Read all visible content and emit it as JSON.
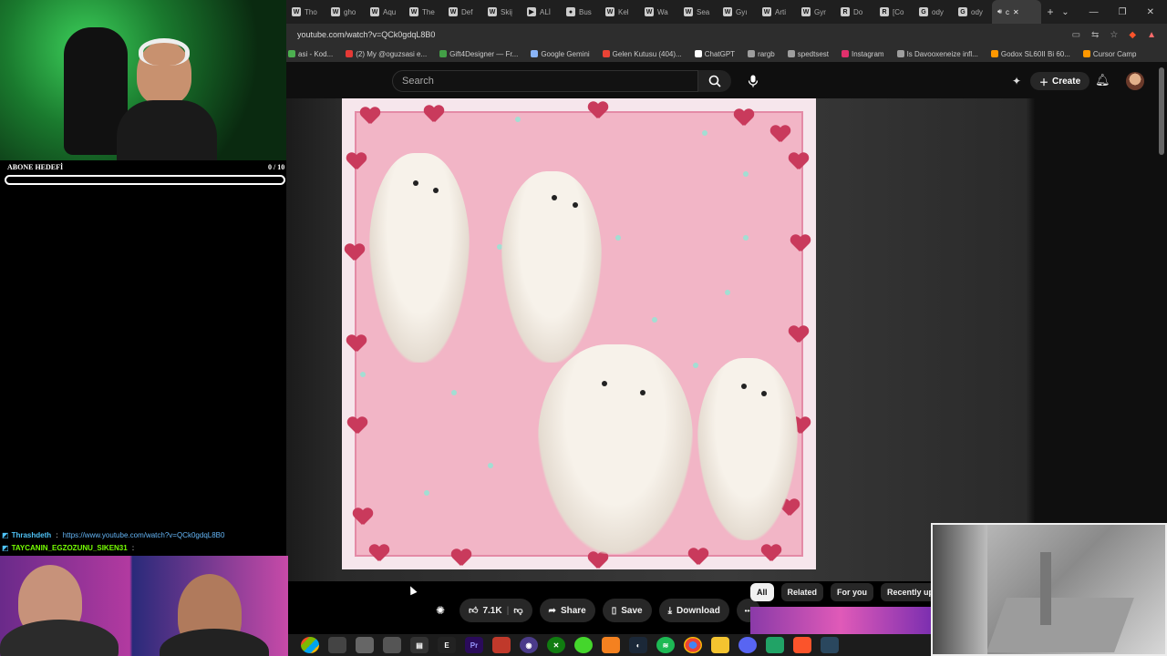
{
  "browser": {
    "tabs": [
      {
        "label": "Tho",
        "fav": "W"
      },
      {
        "label": "gho",
        "fav": "W"
      },
      {
        "label": "Aqu",
        "fav": "W"
      },
      {
        "label": "The",
        "fav": "W"
      },
      {
        "label": "Def",
        "fav": "W"
      },
      {
        "label": "Skiį",
        "fav": "W"
      },
      {
        "label": "ALİ",
        "fav": "▶"
      },
      {
        "label": "Bus",
        "fav": "●"
      },
      {
        "label": "Kel",
        "fav": "W"
      },
      {
        "label": "Wa",
        "fav": "W"
      },
      {
        "label": "Sea",
        "fav": "W"
      },
      {
        "label": "Gyı",
        "fav": "W"
      },
      {
        "label": "Arti",
        "fav": "W"
      },
      {
        "label": "Gyr",
        "fav": "W"
      },
      {
        "label": "Do",
        "fav": "R"
      },
      {
        "label": "[Co",
        "fav": "R"
      },
      {
        "label": "ody",
        "fav": "G"
      },
      {
        "label": "ody",
        "fav": "G"
      }
    ],
    "active_tab": {
      "label": "c",
      "icon": "speaker-icon"
    },
    "new_tab": "+",
    "url": "youtube.com/watch?v=QCk0gdqL8B0",
    "bookmarks": [
      {
        "label": "asi - Kod...",
        "color": "#4caf50"
      },
      {
        "label": "(2) My @oguzsasi e...",
        "color": "#e53935"
      },
      {
        "label": "Gift4Designer — Fr...",
        "color": "#43a047"
      },
      {
        "label": "Google Gemini",
        "color": "#8ab4f8"
      },
      {
        "label": "Gelen Kutusu (404)...",
        "color": "#ea4335"
      },
      {
        "label": "ChatGPT",
        "color": "#ffffff"
      },
      {
        "label": "rargb",
        "color": "#9e9e9e"
      },
      {
        "label": "spedtsest",
        "color": "#9e9e9e"
      },
      {
        "label": "Instagram",
        "color": "#e1306c"
      },
      {
        "label": "Is Davooxeneize infl...",
        "color": "#9e9e9e"
      },
      {
        "label": "Godox SL60II Bi 60...",
        "color": "#ff9800"
      },
      {
        "label": "Cursor Camp",
        "color": "#ff9800"
      }
    ]
  },
  "youtube": {
    "search_placeholder": "Search",
    "create_label": "Create",
    "actions": {
      "like_count": "7.1K",
      "share": "Share",
      "save": "Save",
      "download": "Download",
      "more": "•••"
    },
    "chips": [
      "All",
      "Related",
      "For you",
      "Recently upload"
    ]
  },
  "stream": {
    "goal_label": "ABONE HEDEFİ",
    "goal_count": "0 / 10",
    "goal_progress": 0,
    "chat": [
      {
        "user": "Thrashdeth",
        "sep": " : ",
        "text": "https://www.youtube.com/watch?v=QCk0gdqL8B0",
        "user_color": "#4fc3f7",
        "text_color": "#64b5f6"
      },
      {
        "user": "TAYCANIN_EGZOZUNU_SIKEN31",
        "sep": " : ",
        "text": "",
        "user_color": "#76ff03",
        "text_color": "#ffffff"
      }
    ]
  },
  "colors": {
    "youtube_bg": "#0f0f0f",
    "video_pink": "#f2b5c6",
    "heart": "#c93a5c"
  }
}
